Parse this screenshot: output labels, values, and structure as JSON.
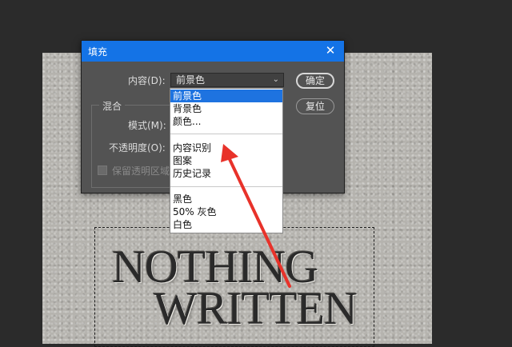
{
  "artwork": {
    "line1": "NOTHING",
    "line2": "WRITTEN"
  },
  "dialog": {
    "title": "填充",
    "content_label": "内容(D):",
    "content_value": "前景色",
    "ok_label": "确定",
    "reset_label": "复位",
    "blend_group_title": "混合",
    "mode_label": "模式(M):",
    "opacity_label": "不透明度(O):",
    "preserve_label": "保留透明区域"
  },
  "dropdown": {
    "group1": [
      "前景色",
      "背景色",
      "颜色..."
    ],
    "group2": [
      "内容识别",
      "图案",
      "历史记录"
    ],
    "group3": [
      "黑色",
      "50% 灰色",
      "白色"
    ]
  },
  "colors": {
    "title_bar": "#1473e6",
    "selection": "#1e73e0",
    "arrow": "#e8322a"
  }
}
